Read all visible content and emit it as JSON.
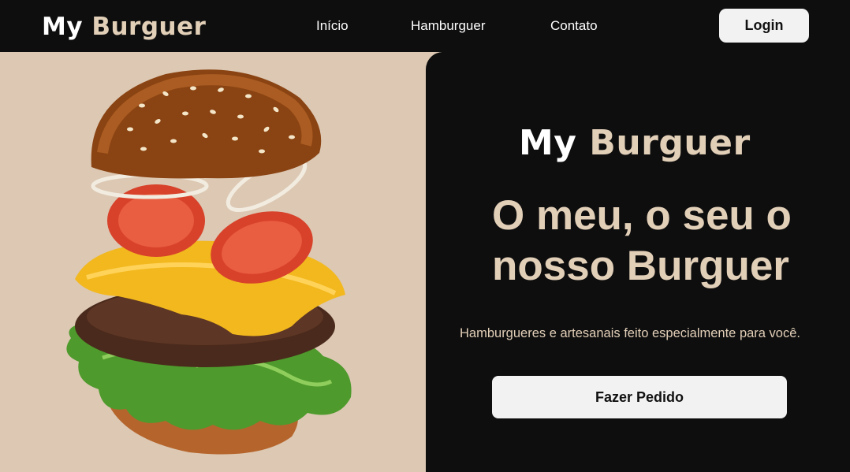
{
  "nav": {
    "logo_part1": "My",
    "logo_part2": "Burguer",
    "links": [
      "Início",
      "Hamburguer",
      "Contato"
    ],
    "login_label": "Login"
  },
  "hero": {
    "logo_part1": "My",
    "logo_part2": "Burguer",
    "headline": "O meu, o seu o nosso Burguer",
    "subtitle": "Hamburgueres e artesanais feito especialmente para você.",
    "cta_label": "Fazer Pedido"
  },
  "colors": {
    "background": "#0e0e0e",
    "accent_beige": "#e2cfb8",
    "image_bg": "#dcc8b3",
    "button_bg": "#f2f2f2"
  }
}
